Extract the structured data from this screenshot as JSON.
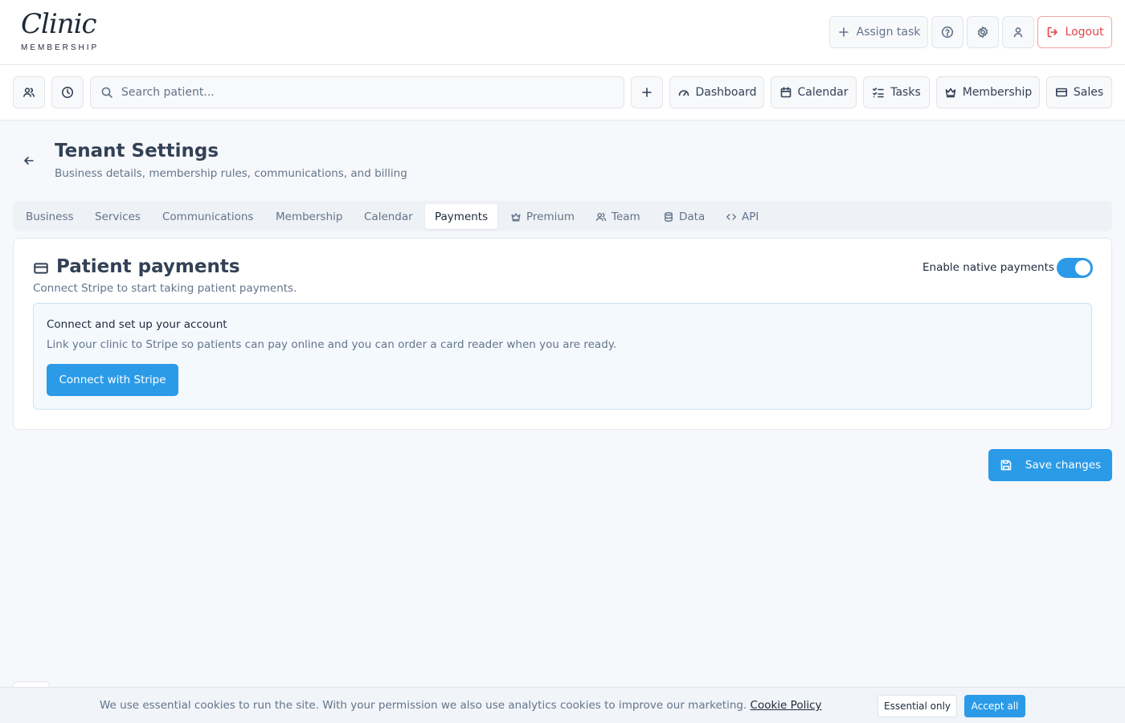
{
  "brand": {
    "logo_script": "Clinic",
    "logo_sub": "MEMBERSHIP"
  },
  "header": {
    "assign_task": "Assign task",
    "logout": "Logout"
  },
  "nav": {
    "search_placeholder": "Search patient...",
    "items": [
      {
        "label": "Dashboard",
        "icon": "gauge-icon"
      },
      {
        "label": "Calendar",
        "icon": "calendar-icon"
      },
      {
        "label": "Tasks",
        "icon": "list-checks-icon"
      },
      {
        "label": "Membership",
        "icon": "crown-icon"
      },
      {
        "label": "Sales",
        "icon": "credit-card-icon"
      }
    ]
  },
  "page": {
    "title": "Tenant Settings",
    "subtitle": "Business details, membership rules, communications, and billing"
  },
  "tabs": [
    {
      "label": "Business"
    },
    {
      "label": "Services"
    },
    {
      "label": "Communications"
    },
    {
      "label": "Membership"
    },
    {
      "label": "Calendar"
    },
    {
      "label": "Payments",
      "active": true
    },
    {
      "label": "Premium",
      "icon": "crown-icon"
    },
    {
      "label": "Team",
      "icon": "users-icon"
    },
    {
      "label": "Data",
      "icon": "database-icon"
    },
    {
      "label": "API",
      "icon": "code-icon"
    }
  ],
  "payments": {
    "title": "Patient payments",
    "subtitle": "Connect Stripe to start taking patient payments.",
    "toggle_label": "Enable native payments",
    "toggle_on": true,
    "connect": {
      "title": "Connect and set up your account",
      "description": "Link your clinic to Stripe so patients can pay online and you can order a card reader when you are ready.",
      "button": "Connect with Stripe"
    }
  },
  "save_button": "Save changes",
  "cookie": {
    "text": "We use essential cookies to run the site. With your permission we also use analytics cookies to improve our marketing.",
    "link": "Cookie Policy",
    "essential": "Essential only",
    "accept": "Accept all"
  },
  "colors": {
    "accent": "#2b9be8",
    "danger": "#e04545",
    "text": "#334155",
    "muted": "#64748b"
  }
}
